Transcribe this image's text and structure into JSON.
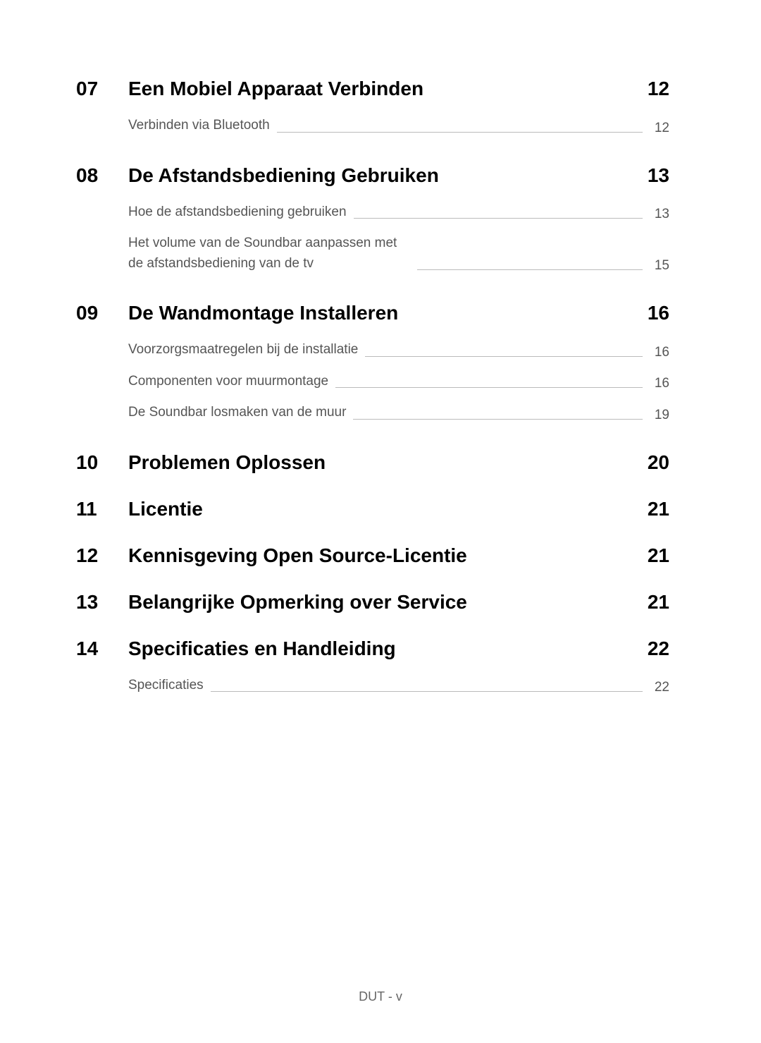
{
  "sections": [
    {
      "num": "07",
      "title": "Een Mobiel Apparaat Verbinden",
      "page": "12",
      "subs": [
        {
          "label": "Verbinden via Bluetooth",
          "page": "12"
        }
      ]
    },
    {
      "num": "08",
      "title": "De Afstandsbediening Gebruiken",
      "page": "13",
      "subs": [
        {
          "label": "Hoe de afstandsbediening gebruiken",
          "page": "13"
        },
        {
          "label": "Het volume van de Soundbar aanpassen met de afstandsbediening van de tv",
          "page": "15"
        }
      ]
    },
    {
      "num": "09",
      "title": "De Wandmontage Installeren",
      "page": "16",
      "subs": [
        {
          "label": "Voorzorgsmaatregelen bij de installatie",
          "page": "16"
        },
        {
          "label": "Componenten voor muurmontage",
          "page": "16"
        },
        {
          "label": "De Soundbar losmaken van de muur",
          "page": "19"
        }
      ]
    },
    {
      "num": "10",
      "title": "Problemen Oplossen",
      "page": "20",
      "subs": []
    },
    {
      "num": "11",
      "title": "Licentie",
      "page": "21",
      "subs": []
    },
    {
      "num": "12",
      "title": "Kennisgeving Open Source-Licentie",
      "page": "21",
      "subs": []
    },
    {
      "num": "13",
      "title": "Belangrijke Opmerking over Service",
      "page": "21",
      "subs": []
    },
    {
      "num": "14",
      "title": "Specificaties en Handleiding",
      "page": "22",
      "subs": [
        {
          "label": "Specificaties",
          "page": "22"
        }
      ]
    }
  ],
  "footer": "DUT - v"
}
